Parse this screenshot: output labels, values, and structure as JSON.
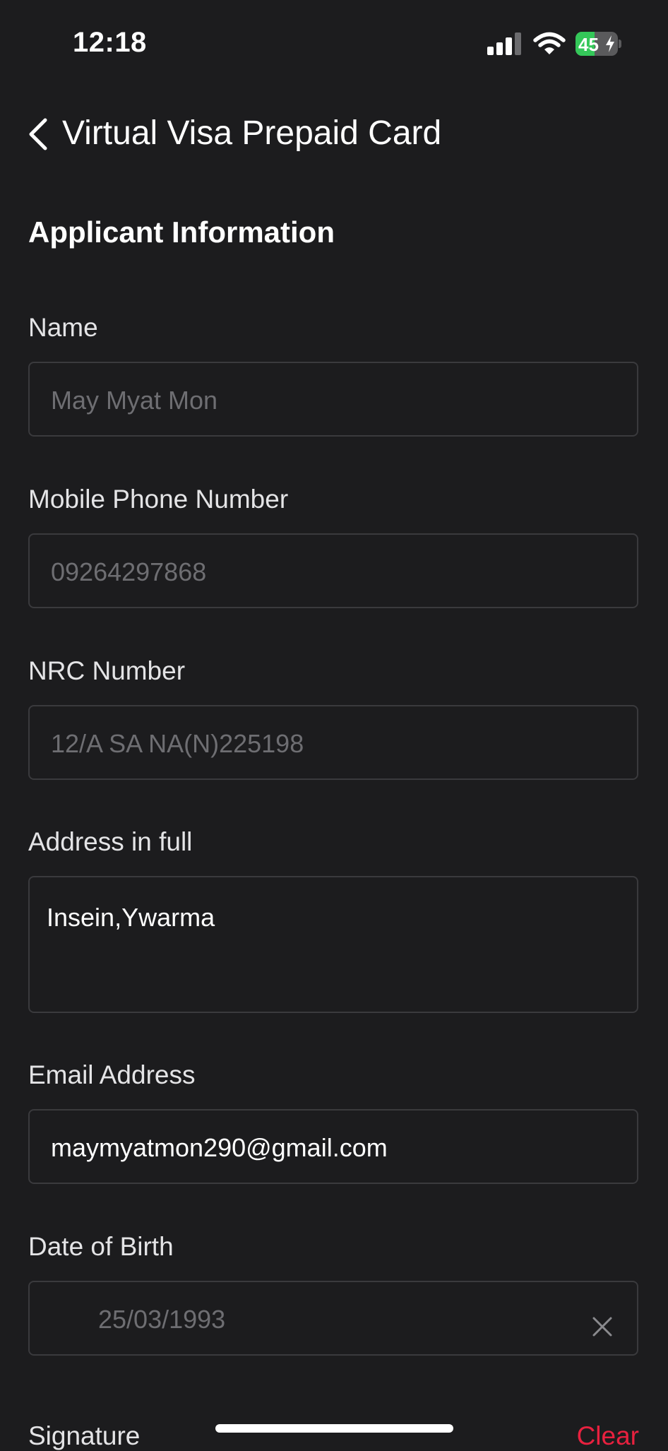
{
  "status_bar": {
    "time": "12:18",
    "battery_level": "45",
    "battery_fraction": 0.45,
    "signal_bars_active": 3,
    "signal_bars_total": 4,
    "icons": [
      "signal-icon",
      "wifi-icon",
      "battery-icon",
      "charging-bolt-icon"
    ]
  },
  "nav": {
    "back_icon": "chevron-left-icon",
    "title": "Virtual Visa Prepaid Card"
  },
  "section": {
    "title": "Applicant Information"
  },
  "form": {
    "name": {
      "label": "Name",
      "value": "May Myat Mon"
    },
    "mobile": {
      "label": "Mobile Phone Number",
      "value": "09264297868"
    },
    "nrc": {
      "label": "NRC Number",
      "value": "12/A SA NA(N)225198"
    },
    "address": {
      "label": "Address in full",
      "value": "Insein,Ywarma"
    },
    "email": {
      "label": "Email Address",
      "value": "maymyatmon290@gmail.com"
    },
    "dob": {
      "label": "Date of Birth",
      "value": "25/03/1993",
      "clear_icon": "close-icon"
    },
    "signature": {
      "label": "Signature",
      "clear_label": "Clear"
    }
  },
  "colors": {
    "background": "#1c1c1e",
    "field_border": "#3a3a3d",
    "muted_text": "#6e6e72",
    "accent_red": "#e8213f",
    "battery_green": "#34c759"
  }
}
